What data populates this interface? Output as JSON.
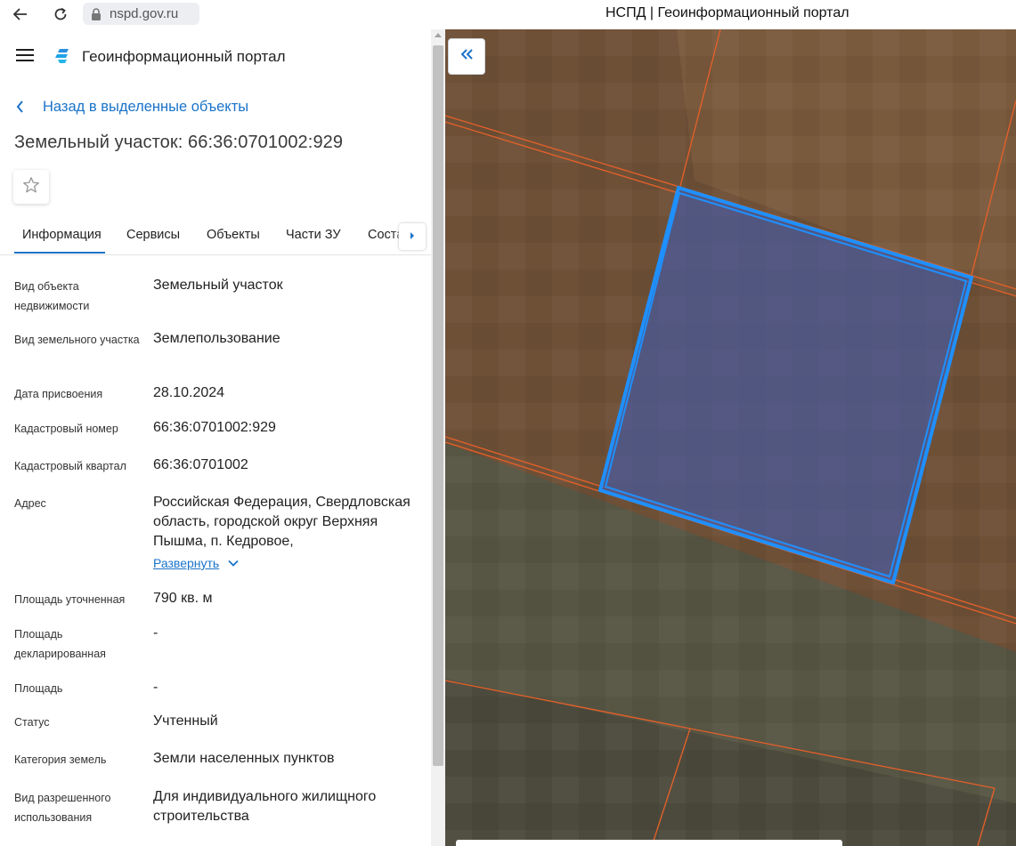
{
  "browser": {
    "url": "nspd.gov.ru",
    "tab_title": "НСПД | Геоинформационный портал"
  },
  "header": {
    "portal_title": "Геоинформационный портал"
  },
  "back_link": "Назад в выделенные объекты",
  "object_title": "Земельный участок: 66:36:0701002:929",
  "tabs": [
    "Информация",
    "Сервисы",
    "Объекты",
    "Части ЗУ",
    "Состав ЗУ"
  ],
  "active_tab": "Информация",
  "info": [
    {
      "label": "Вид объекта недвижимости",
      "value": "Земельный участок"
    },
    {
      "label": "Вид земельного участка",
      "value": "Землепользование"
    },
    {
      "label": "Дата присвоения",
      "value": "28.10.2024"
    },
    {
      "label": "Кадастровый номер",
      "value": "66:36:0701002:929"
    },
    {
      "label": "Кадастровый квартал",
      "value": "66:36:0701002"
    },
    {
      "label": "Адрес",
      "value": "Российская Федерация, Свердловская область, городской округ Верхняя Пышма, п. Кедровое,"
    },
    {
      "label": "Площадь уточненная",
      "value": "790 кв. м"
    },
    {
      "label": "Площадь декларированная",
      "value": "-"
    },
    {
      "label": "Площадь",
      "value": "-"
    },
    {
      "label": "Статус",
      "value": "Учтенный"
    },
    {
      "label": "Категория земель",
      "value": "Земли населенных пунктов"
    },
    {
      "label": "Вид разрешенного использования",
      "value": "Для индивидуального жилищного строительства"
    }
  ],
  "expand_link": "Развернуть",
  "colors": {
    "accent": "#1a73c9",
    "parcel_outline": "#1e90ff",
    "parcel_fill": "#4a5a9a",
    "cadastral_lines": "#e0602a"
  }
}
